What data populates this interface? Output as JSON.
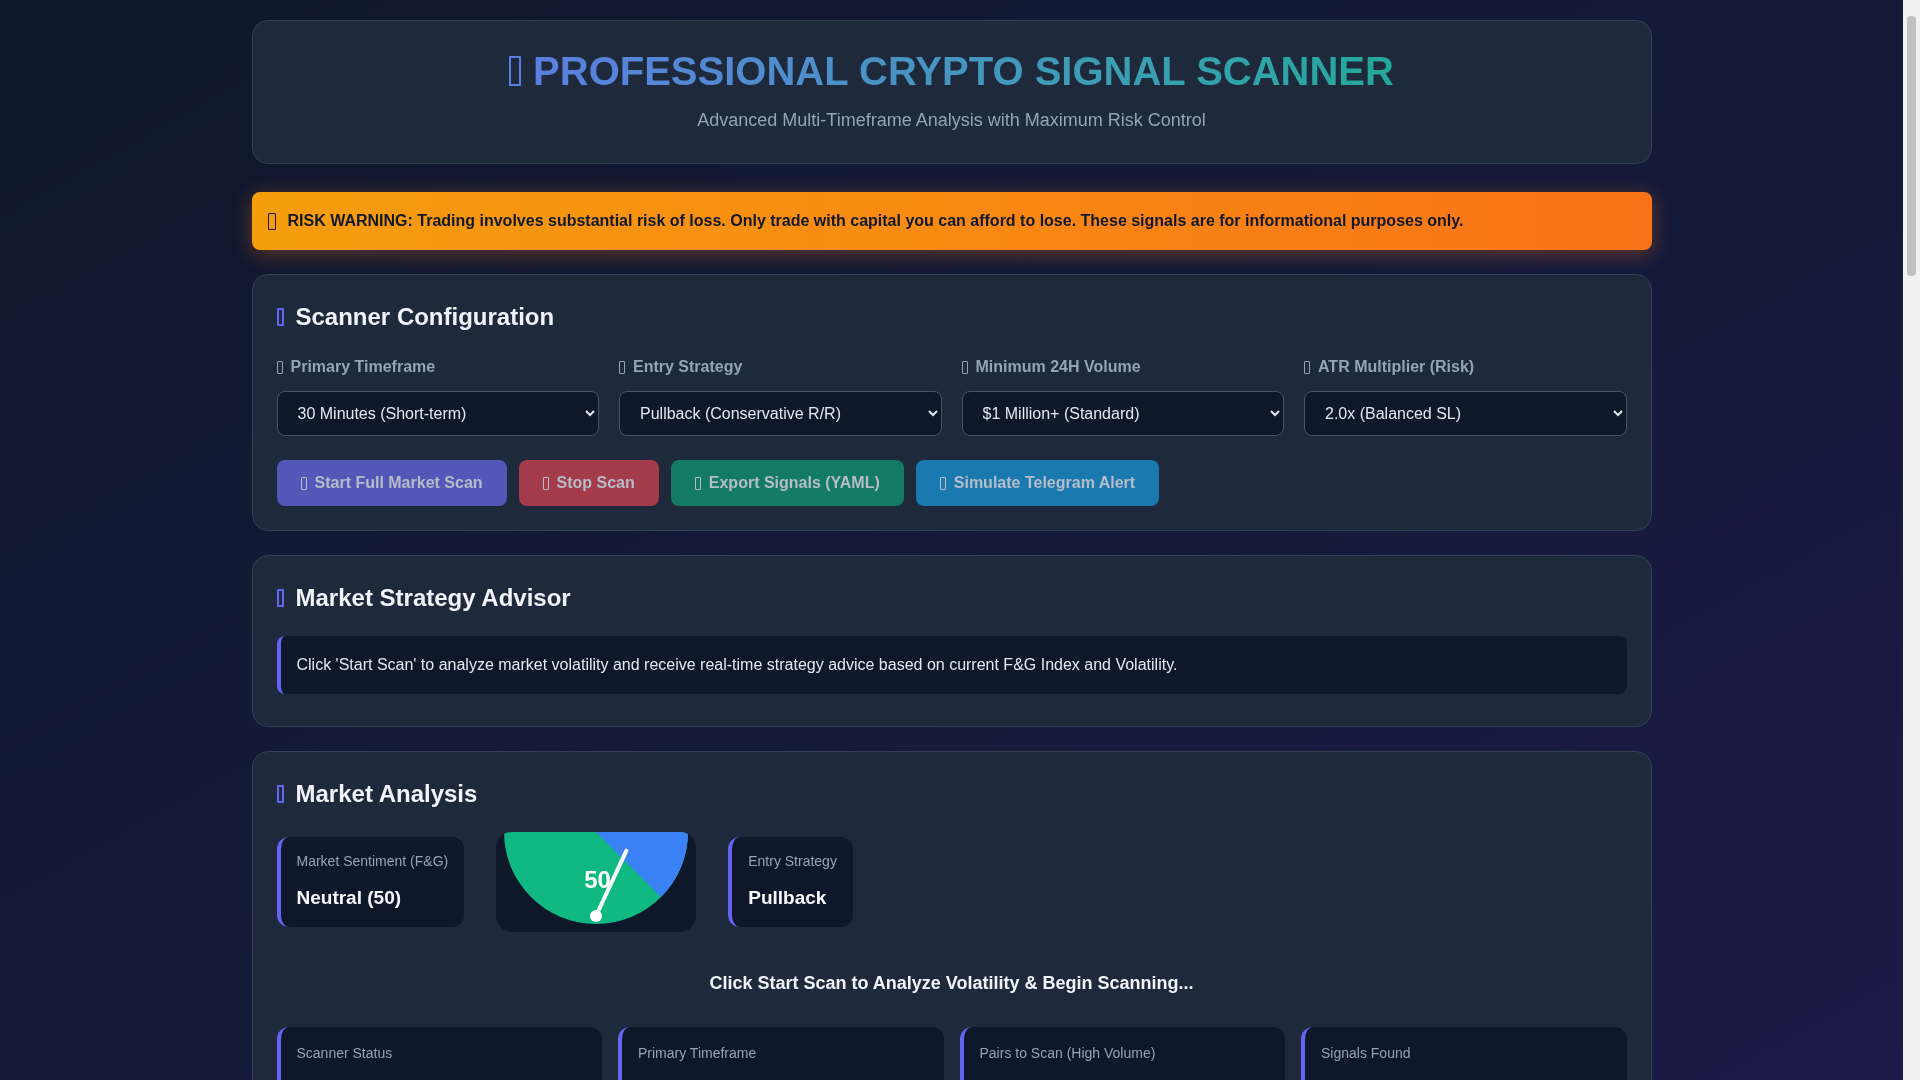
{
  "header": {
    "title": "PROFESSIONAL CRYPTO SIGNAL SCANNER",
    "subtitle": "Advanced Multi-Timeframe Analysis with Maximum Risk Control"
  },
  "warning": {
    "text": "RISK WARNING: Trading involves substantial risk of loss. Only trade with capital you can afford to lose. These signals are for informational purposes only."
  },
  "configuration": {
    "title": "Scanner Configuration",
    "fields": [
      {
        "label": "Primary Timeframe",
        "value": "30 Minutes (Short-term)"
      },
      {
        "label": "Entry Strategy",
        "value": "Pullback (Conservative R/R)"
      },
      {
        "label": "Minimum 24H Volume",
        "value": "$1 Million+ (Standard)"
      },
      {
        "label": "ATR Multiplier (Risk)",
        "value": "2.0x (Balanced SL)"
      }
    ],
    "buttons": [
      {
        "kind": "start",
        "label": "Start Full Market Scan"
      },
      {
        "kind": "stop",
        "label": "Stop Scan"
      },
      {
        "kind": "export",
        "label": "Export Signals (YAML)"
      },
      {
        "kind": "telegram",
        "label": "Simulate Telegram Alert"
      }
    ]
  },
  "advisor": {
    "title": "Market Strategy Advisor",
    "message": "Click 'Start Scan' to analyze market volatility and receive real-time strategy advice based on current F&G Index and Volatility."
  },
  "analysis": {
    "title": "Market Analysis",
    "sentiment": {
      "label": "Market Sentiment (F&G)",
      "value": "Neutral (50)"
    },
    "gauge": {
      "reading": "50"
    },
    "strategy": {
      "label": "Entry Strategy",
      "value": "Pullback"
    },
    "prompt": "Click Start Scan to Analyze Volatility & Begin Scanning...",
    "stats": [
      {
        "label": "Scanner Status"
      },
      {
        "label": "Primary Timeframe"
      },
      {
        "label": "Pairs to Scan (High Volume)"
      },
      {
        "label": "Signals Found"
      }
    ]
  }
}
